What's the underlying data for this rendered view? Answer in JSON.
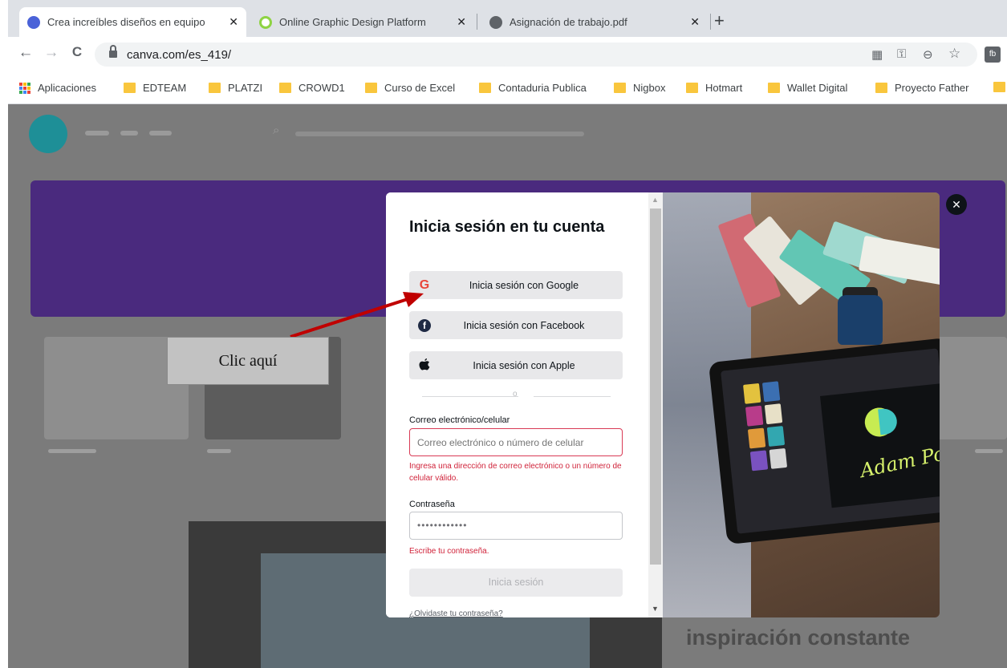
{
  "browser": {
    "tabs": [
      {
        "title": "Crea increíbles diseños en equipo",
        "close": "✕",
        "active": true,
        "favicon_color": "#4a62d8"
      },
      {
        "title": "Online Graphic Design Platform",
        "close": "✕",
        "active": false,
        "favicon_color": "#8ed343"
      },
      {
        "title": "Asignación de trabajo.pdf",
        "close": "✕",
        "active": false,
        "favicon_color": "#5f6368"
      }
    ],
    "new_tab": "+",
    "nav": {
      "back": "←",
      "forward": "→",
      "reload": "C"
    },
    "url": "canva.com/es_419/",
    "omnibox_icons": {
      "qr": "▦",
      "key": "⚿",
      "zoom": "⊖",
      "star": "☆",
      "extension": "fb"
    },
    "bookmarks": [
      {
        "label": "Aplicaciones",
        "icon": "apps-grid-icon"
      },
      {
        "label": "EDTEAM",
        "icon": "folder-icon"
      },
      {
        "label": "PLATZI",
        "icon": "folder-icon"
      },
      {
        "label": "CROWD1",
        "icon": "folder-icon"
      },
      {
        "label": "Curso de Excel",
        "icon": "folder-icon"
      },
      {
        "label": "Contaduria Publica",
        "icon": "folder-icon"
      },
      {
        "label": "Nigbox",
        "icon": "folder-icon"
      },
      {
        "label": "Hotmart",
        "icon": "folder-icon"
      },
      {
        "label": "Wallet Digital",
        "icon": "folder-icon"
      },
      {
        "label": "Proyecto Father",
        "icon": "folder-icon"
      }
    ]
  },
  "page_background": {
    "promo_heading": "encuentra una fuente de inspiración constante"
  },
  "login_modal": {
    "title": "Inicia sesión en tu cuenta",
    "sso": [
      {
        "label": "Inicia sesión con Google",
        "icon": "google-icon",
        "glyph": "G",
        "color": "#e9453a"
      },
      {
        "label": "Inicia sesión con Facebook",
        "icon": "facebook-icon",
        "glyph": "f",
        "color": "#1f2a44"
      },
      {
        "label": "Inicia sesión con Apple",
        "icon": "apple-icon",
        "glyph": "",
        "color": "#0e1318"
      }
    ],
    "divider": "o",
    "email": {
      "label": "Correo electrónico/celular",
      "placeholder": "Correo electrónico o número de celular",
      "value": "",
      "error": "Ingresa una dirección de correo electrónico o un número de celular válido."
    },
    "password": {
      "label": "Contraseña",
      "value": "••••••••••••",
      "error": "Escribe tu contraseña."
    },
    "submit": "Inicia sesión",
    "forgot": "¿Olvidaste tu contraseña?",
    "close": "✕",
    "photo_signature": "Adam Powell"
  },
  "annotation": {
    "callout": "Clic aquí",
    "arrow_color": "#c00000"
  },
  "colors": {
    "error": "#d0233a",
    "brand_teal": "#1e8f97",
    "brand_purple": "#4a2a7e"
  }
}
